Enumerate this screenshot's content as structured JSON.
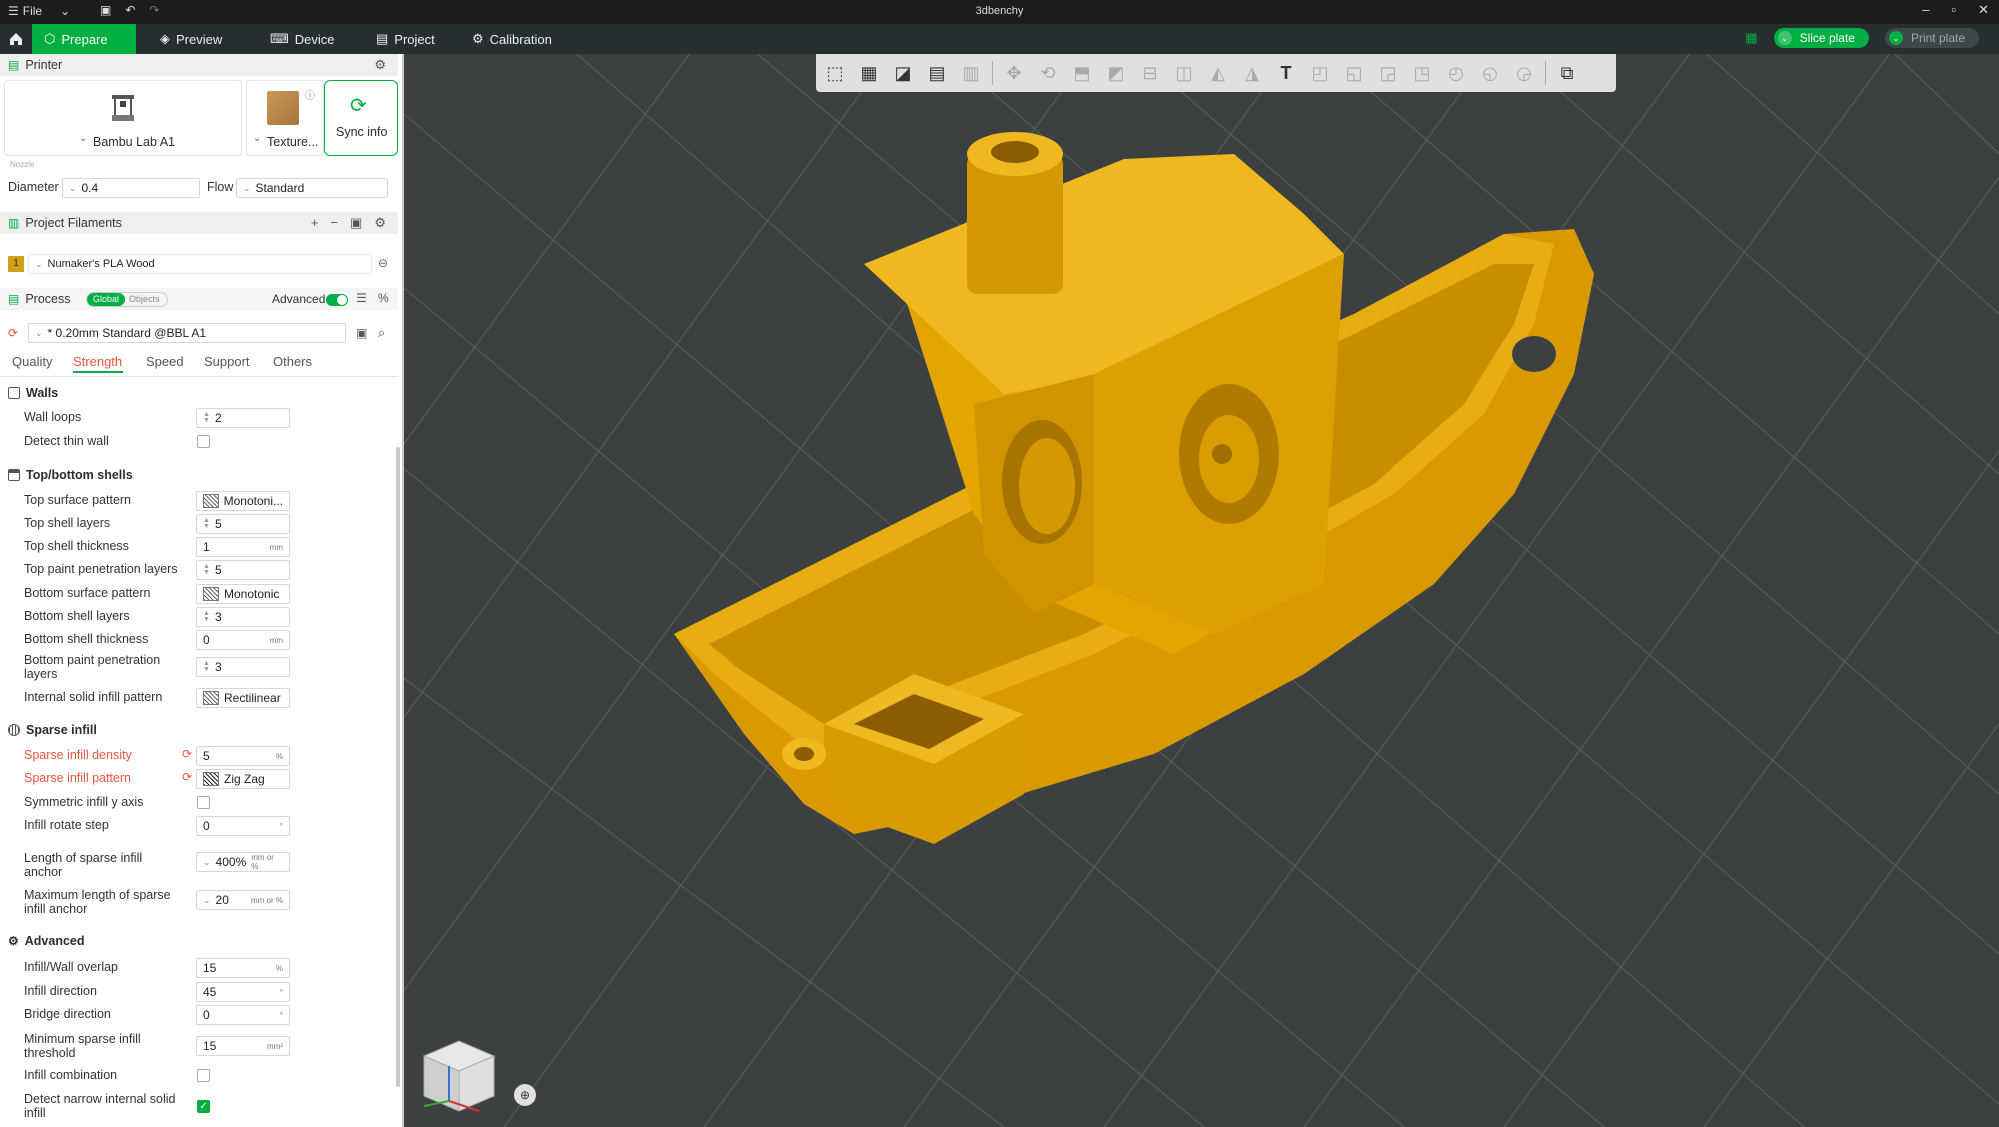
{
  "titlebar": {
    "file_label": "File",
    "title": "3dbenchy",
    "icons": [
      "menu-icon",
      "chevron-down-icon",
      "save-icon",
      "undo-icon",
      "redo-icon",
      "minimize-icon",
      "maximize-icon",
      "close-icon"
    ]
  },
  "menubar": {
    "tabs": [
      {
        "label": "Prepare",
        "icon": "prepare-icon",
        "active": true
      },
      {
        "label": "Preview",
        "icon": "preview-icon",
        "active": false
      },
      {
        "label": "Device",
        "icon": "device-icon",
        "active": false
      },
      {
        "label": "Project",
        "icon": "project-icon",
        "active": false
      },
      {
        "label": "Calibration",
        "icon": "calibration-icon",
        "active": false
      }
    ],
    "slice_label": "Slice plate",
    "print_label": "Print plate",
    "accent_color": "#00ae42"
  },
  "printer": {
    "header": "Printer",
    "name": "Bambu Lab A1",
    "plate": "Texture...",
    "sync_label": "Sync info",
    "nozzle_label": "Nozzle",
    "diameter_label": "Diameter",
    "diameter_value": "0.4",
    "flow_label": "Flow",
    "flow_value": "Standard"
  },
  "filaments": {
    "header": "Project Filaments",
    "items": [
      {
        "index": "1",
        "name": "Numaker's PLA Wood",
        "color": "#d4a017"
      }
    ]
  },
  "process": {
    "header": "Process",
    "toggle_global": "Global",
    "toggle_objects": "Objects",
    "advanced_label": "Advanced",
    "profile": "* 0.20mm Standard @BBL A1",
    "tabs": [
      "Quality",
      "Strength",
      "Speed",
      "Support",
      "Others"
    ],
    "active_tab": "Strength"
  },
  "walls": {
    "title": "Walls",
    "wall_loops_label": "Wall loops",
    "wall_loops": "2",
    "detect_thin_label": "Detect thin wall"
  },
  "shells": {
    "title": "Top/bottom shells",
    "top_pattern_label": "Top surface pattern",
    "top_pattern": "Monotoni...",
    "top_layers_label": "Top shell layers",
    "top_layers": "5",
    "top_thickness_label": "Top shell thickness",
    "top_thickness": "1",
    "top_paint_label": "Top paint penetration layers",
    "top_paint": "5",
    "bottom_pattern_label": "Bottom surface pattern",
    "bottom_pattern": "Monotonic",
    "bottom_layers_label": "Bottom shell layers",
    "bottom_layers": "3",
    "bottom_thickness_label": "Bottom shell thickness",
    "bottom_thickness": "0",
    "bottom_paint_label": "Bottom paint penetration layers",
    "bottom_paint": "3",
    "internal_pattern_label": "Internal solid infill pattern",
    "internal_pattern": "Rectilinear",
    "unit_mm": "mm"
  },
  "sparse": {
    "title": "Sparse infill",
    "density_label": "Sparse infill density",
    "density": "5",
    "pattern_label": "Sparse infill pattern",
    "pattern": "Zig Zag",
    "symmetric_label": "Symmetric infill y axis",
    "rotate_label": "Infill rotate step",
    "rotate": "0",
    "anchor_label": "Length of sparse infill anchor",
    "anchor": "400%",
    "max_anchor_label": "Maximum length of sparse infill anchor",
    "max_anchor": "20",
    "unit_pct": "%",
    "unit_deg": "°",
    "unit_mm_or_pct": "mm or %"
  },
  "advanced": {
    "title": "Advanced",
    "overlap_label": "Infill/Wall overlap",
    "overlap": "15",
    "direction_label": "Infill direction",
    "direction": "45",
    "bridge_label": "Bridge direction",
    "bridge": "0",
    "min_sparse_label": "Minimum sparse infill threshold",
    "min_sparse": "15",
    "unit_mm2": "mm²",
    "combination_label": "Infill combination",
    "narrow_label": "Detect narrow internal solid infill"
  },
  "viewport": {
    "model_color": "#e3a600",
    "bg_color": "#3d4041"
  }
}
